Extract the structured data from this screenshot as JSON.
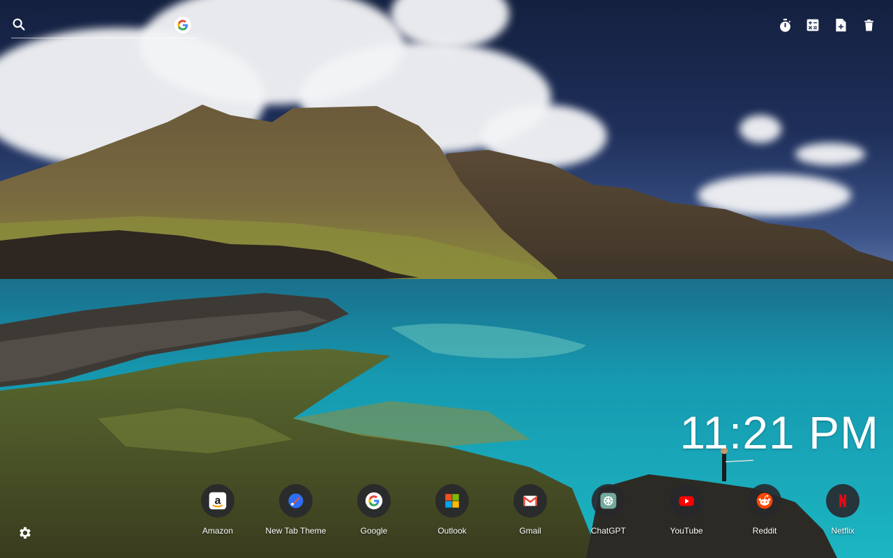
{
  "search": {
    "placeholder": "",
    "engine_icon": "google-icon"
  },
  "toolbar": {
    "icons": [
      "timer-icon",
      "calculator-icon",
      "note-add-icon",
      "trash-icon"
    ]
  },
  "clock": {
    "time": "11:21 PM"
  },
  "shortcuts": [
    {
      "label": "Amazon",
      "icon": "amazon-icon"
    },
    {
      "label": "New Tab Theme",
      "icon": "new-tab-theme-icon"
    },
    {
      "label": "Google",
      "icon": "google-icon"
    },
    {
      "label": "Outlook",
      "icon": "outlook-icon"
    },
    {
      "label": "Gmail",
      "icon": "gmail-icon"
    },
    {
      "label": "ChatGPT",
      "icon": "chatgpt-icon"
    },
    {
      "label": "YouTube",
      "icon": "youtube-icon"
    },
    {
      "label": "Reddit",
      "icon": "reddit-icon"
    },
    {
      "label": "Netflix",
      "icon": "netflix-icon"
    }
  ],
  "settings": {
    "icon": "gear-icon"
  },
  "colors": {
    "sky": "#1e2f5a",
    "sea": "#18a2b8",
    "shortcut_bg": "#28282c",
    "text": "#ffffff"
  }
}
